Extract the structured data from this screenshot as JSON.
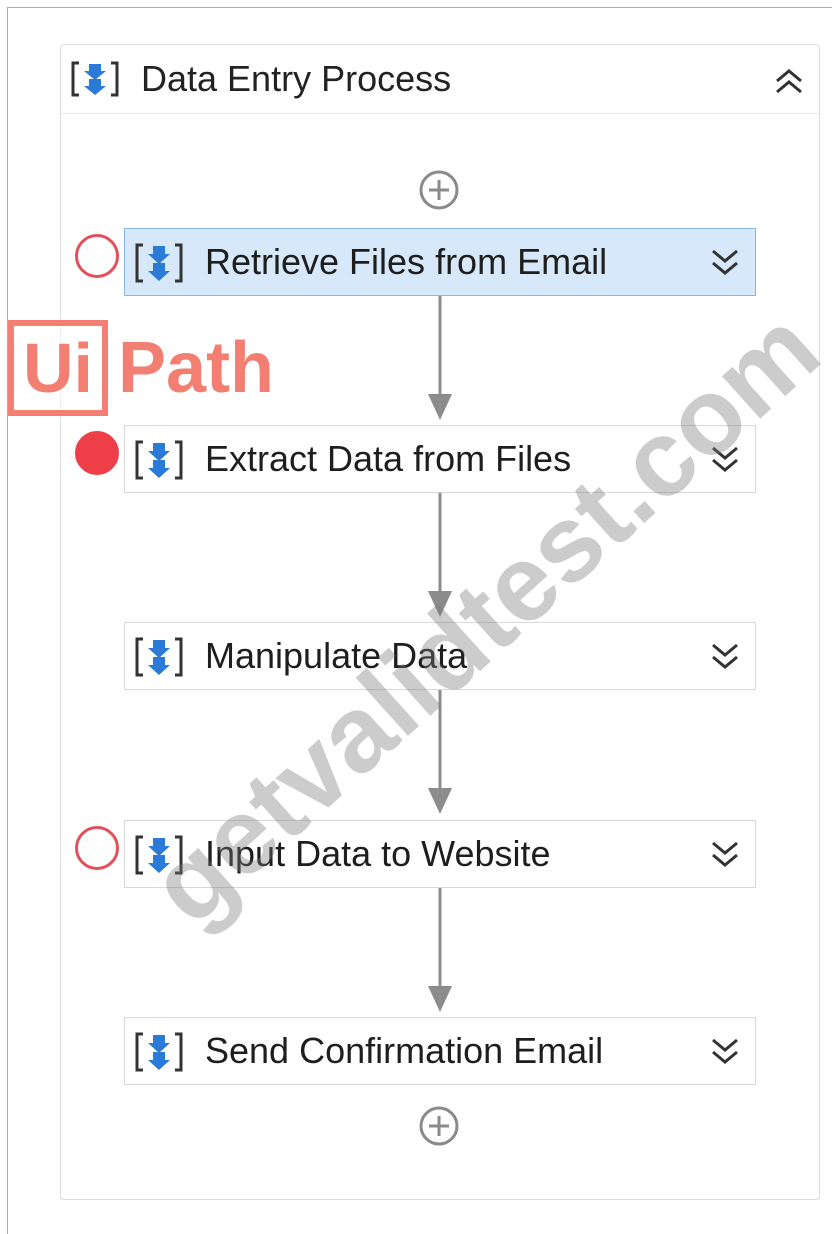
{
  "sequence": {
    "title": "Data Entry Process",
    "collapse_icon": "chevron-double-up-icon",
    "activities": [
      {
        "label": "Retrieve Files from Email",
        "selected": true,
        "breakpoint": "disabled"
      },
      {
        "label": "Extract Data from Files",
        "selected": false,
        "breakpoint": "enabled"
      },
      {
        "label": "Manipulate Data",
        "selected": false,
        "breakpoint": "none"
      },
      {
        "label": "Input Data to Website",
        "selected": false,
        "breakpoint": "disabled"
      },
      {
        "label": "Send Confirmation Email",
        "selected": false,
        "breakpoint": "none"
      }
    ]
  },
  "overlay": {
    "logo_left": "Ui",
    "logo_right": "Path",
    "watermark": "getvalidtest.com"
  },
  "colors": {
    "selected_bg": "#d6e8fa",
    "breakpoint_red": "#ee3e48",
    "icon_blue": "#2a7bd8",
    "logo_coral": "#f27f72"
  }
}
